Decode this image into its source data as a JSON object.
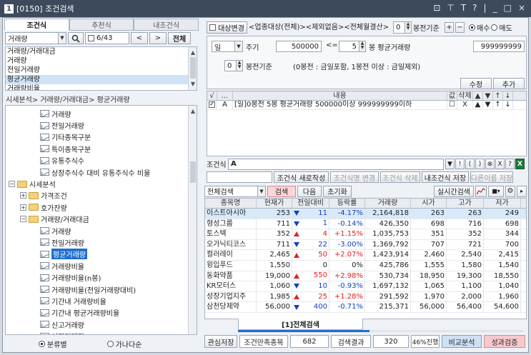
{
  "window": {
    "number": "1",
    "title": "[0150] 조건검색",
    "controls": [
      "⊡",
      "⊤",
      "T",
      "?",
      "|",
      "_",
      "□",
      "×"
    ]
  },
  "left": {
    "tabs": [
      {
        "label": "조건식",
        "active": true
      },
      {
        "label": "추천식",
        "active": false
      },
      {
        "label": "내조건식",
        "active": false
      }
    ],
    "category_select": "거래량",
    "page_indicator": "6/43",
    "prev_label": "<",
    "next_label": ">",
    "all_label": "전체",
    "search_results": [
      "거래량/거래대금",
      "거래량",
      "전일거래량",
      "평균거래량",
      "거래량비율"
    ],
    "search_selected_index": 3,
    "breadcrumb": "시세분석> 거래량/거래대금> 평균거래량",
    "tree": [
      {
        "level": 2,
        "kind": "item",
        "label": "거래량"
      },
      {
        "level": 2,
        "kind": "item",
        "label": "전일거래량"
      },
      {
        "level": 2,
        "kind": "item",
        "label": "기타종목구분"
      },
      {
        "level": 2,
        "kind": "item",
        "label": "특이종목구분"
      },
      {
        "level": 2,
        "kind": "item",
        "label": "유통주식수"
      },
      {
        "level": 2,
        "kind": "item",
        "label": "상장주식수 대비 유통주식수 비율"
      },
      {
        "level": 0,
        "kind": "folder",
        "pm": "−",
        "label": "시세분석"
      },
      {
        "level": 1,
        "kind": "folder",
        "pm": "+",
        "label": "가격조건"
      },
      {
        "level": 1,
        "kind": "folder",
        "pm": "+",
        "label": "호가잔량"
      },
      {
        "level": 1,
        "kind": "folder",
        "pm": "−",
        "label": "거래량/거래대금"
      },
      {
        "level": 2,
        "kind": "item",
        "label": "거래량"
      },
      {
        "level": 2,
        "kind": "item",
        "label": "전일거래량"
      },
      {
        "level": 2,
        "kind": "item",
        "label": "평균거래량",
        "selected": true
      },
      {
        "level": 2,
        "kind": "item",
        "label": "거래량비율"
      },
      {
        "level": 2,
        "kind": "item",
        "label": "거래량비율(n봉)"
      },
      {
        "level": 2,
        "kind": "item",
        "label": "거래량비율(전일거래량대비)"
      },
      {
        "level": 2,
        "kind": "item",
        "label": "기간내 거래량비율"
      },
      {
        "level": 2,
        "kind": "item",
        "label": "기간내 평균거래량비율"
      },
      {
        "level": 2,
        "kind": "item",
        "label": "신고거래량"
      },
      {
        "level": 2,
        "kind": "item",
        "label": "신저거래량"
      }
    ],
    "radio_category": "분류별",
    "radio_alpha": "가나다순"
  },
  "criteria": {
    "target_change_label": "대상변경",
    "filter_text": "<업종대상(전체)><제외없음><전체월결산>",
    "bong_count": "0",
    "bong_label": "봉전기준",
    "plus_label": "+",
    "minus_label": "−",
    "buy_label": "매수",
    "sell_label": "매도",
    "period_select": "일",
    "period_label": "주기",
    "volume_min": "500000",
    "le_symbol": "<=",
    "bong_n": "5",
    "avg_label": "봉 평균거래량",
    "volume_max": "999999999",
    "base_count": "0",
    "base_label": "봉전기준",
    "note": "(0봉전 : 금일포함, 1봉전 이상 : 금일제외)",
    "edit_label": "수정",
    "add_label": "추가"
  },
  "conditions": {
    "headers": [
      "√",
      "...",
      "내용",
      "값",
      "삭제",
      "▲",
      "▼",
      "↑",
      "↓"
    ],
    "rows": [
      {
        "checked": true,
        "id": "A",
        "content": "[일]0봉전 5봉 평균거래량 500000이상 999999999이하",
        "value_icon": "☐",
        "delete_icon": "X",
        "up": "▲",
        "down": "▼",
        "top": "↑",
        "bottom": "↓"
      }
    ]
  },
  "formula": {
    "label": "조건식",
    "value": "A",
    "tools": [
      "▼",
      "!",
      "(",
      ")",
      "⊗",
      "X",
      "?",
      "X"
    ],
    "buttons": [
      {
        "label": "조건식 새로작성",
        "dim": false
      },
      {
        "label": "조건식명 변경",
        "dim": true
      },
      {
        "label": "조건식 삭제",
        "dim": true
      },
      {
        "label": "내조건식 저장",
        "dim": false
      },
      {
        "label": "다른이름 저장",
        "dim": true
      }
    ]
  },
  "search_bar": {
    "scope_select": "전체검색",
    "search_label": "검색",
    "next_label": "다음",
    "reset_label": "초기화",
    "realtime_label": "실시간검색"
  },
  "results": {
    "columns": [
      "종목명",
      "현재가",
      "전일대비",
      "등락률",
      "거래량",
      "시가",
      "고가",
      "저가"
    ],
    "rows": [
      {
        "name": "이스트아시아",
        "price": "253",
        "dir": "down",
        "change": "11",
        "rate": "-4.17%",
        "volume": "2,164,818",
        "open": "263",
        "high": "263",
        "low": "249",
        "selected": true
      },
      {
        "name": "형성그룹",
        "price": "711",
        "dir": "down",
        "change": "1",
        "rate": "-0.14%",
        "volume": "426,350",
        "open": "698",
        "high": "716",
        "low": "698"
      },
      {
        "name": "토스텍",
        "price": "352",
        "dir": "up",
        "change": "4",
        "rate": "+1.15%",
        "volume": "1,035,753",
        "open": "351",
        "high": "352",
        "low": "344"
      },
      {
        "name": "오가닉티코스",
        "price": "711",
        "dir": "down",
        "change": "22",
        "rate": "-3.00%",
        "volume": "1,369,792",
        "open": "707",
        "high": "721",
        "low": "700"
      },
      {
        "name": "컬러레이",
        "price": "2,465",
        "dir": "up",
        "change": "50",
        "rate": "+2.07%",
        "volume": "1,423,914",
        "open": "2,460",
        "high": "2,540",
        "low": "2,415"
      },
      {
        "name": "윙입푸드",
        "price": "1,550",
        "dir": "none",
        "change": "0",
        "rate": "0%",
        "volume": "425,786",
        "open": "1,555",
        "high": "1,580",
        "low": "1,540"
      },
      {
        "name": "동화약품",
        "price": "19,000",
        "dir": "up",
        "change": "550",
        "rate": "+2.98%",
        "volume": "530,734",
        "open": "18,950",
        "high": "19,300",
        "low": "18,550"
      },
      {
        "name": "KR모터스",
        "price": "1,060",
        "dir": "down",
        "change": "10",
        "rate": "-0.93%",
        "volume": "1,697,132",
        "open": "1,065",
        "high": "1,100",
        "low": "1,040"
      },
      {
        "name": "성장기업지주",
        "price": "1,985",
        "dir": "up",
        "change": "25",
        "rate": "+1.28%",
        "volume": "291,592",
        "open": "1,970",
        "high": "2,000",
        "low": "1,960"
      },
      {
        "name": "삼천당제약",
        "price": "56,000",
        "dir": "down",
        "change": "400",
        "rate": "-0.71%",
        "volume": "215,371",
        "open": "56,000",
        "high": "56,400",
        "low": "54,600"
      }
    ],
    "tab_label": "[1]전체검색",
    "progress_fraction": 0.46
  },
  "footer": {
    "watchlist_label": "관심저장",
    "match_label": "조건만족종목",
    "match_count": "682",
    "result_label": "검색결과",
    "result_count": "320",
    "progress_label": "46%진행",
    "compare_label": "비교분석",
    "verify_label": "성과검증"
  },
  "colors": {
    "up": "#e02020",
    "down": "#1040c0",
    "titlebar": "#3c4a5c",
    "selected_tree": "#1f6fd0",
    "verify_button": "#f7c9cf",
    "compare_button": "#cfe0f5"
  }
}
